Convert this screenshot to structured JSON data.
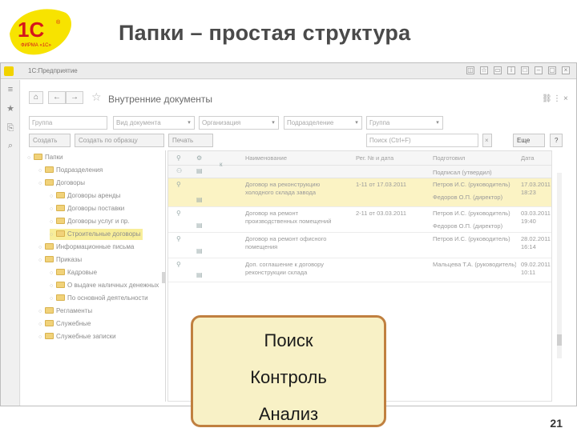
{
  "slide": {
    "title": "Папки – простая структура",
    "page_number": "21",
    "logo": {
      "brand": "1С",
      "subtext": "ФИРМА «1С»",
      "colors": {
        "yellow": "#f7e300",
        "red": "#d5161c"
      }
    }
  },
  "window": {
    "title": "1С:Предприятие",
    "controls": [
      "◫",
      "☆",
      "▭",
      "i",
      "□",
      "‒",
      "▢",
      "×"
    ]
  },
  "form": {
    "title": "Внутренние документы",
    "filters": [
      {
        "placeholder": "Группа"
      },
      {
        "placeholder": "Вид документа"
      },
      {
        "placeholder": "Организация"
      },
      {
        "placeholder": "Подразделение"
      },
      {
        "placeholder": "Группа"
      }
    ],
    "toolbar": {
      "create": "Создать",
      "create_by_template": "Создать по образцу",
      "print": "Печать",
      "more": "Еще",
      "help": "?",
      "search_placeholder": "Поиск (Ctrl+F)"
    }
  },
  "tree": [
    {
      "label": "Папки",
      "level": 0,
      "selected": false
    },
    {
      "label": "Подразделения",
      "level": 1,
      "selected": false
    },
    {
      "label": "Договоры",
      "level": 1,
      "selected": false
    },
    {
      "label": "Договоры аренды",
      "level": 2,
      "selected": false
    },
    {
      "label": "Договоры поставки",
      "level": 2,
      "selected": false
    },
    {
      "label": "Договоры услуг и пр.",
      "level": 2,
      "selected": false
    },
    {
      "label": "Строительные договоры",
      "level": 2,
      "selected": true
    },
    {
      "label": "Информационные письма",
      "level": 1,
      "selected": false
    },
    {
      "label": "Приказы",
      "level": 1,
      "selected": false
    },
    {
      "label": "Кадровые",
      "level": 2,
      "selected": false
    },
    {
      "label": "О выдаче наличных денежных",
      "level": 2,
      "selected": false
    },
    {
      "label": "По основной деятельности",
      "level": 2,
      "selected": false
    },
    {
      "label": "Регламенты",
      "level": 1,
      "selected": false
    },
    {
      "label": "Служебные",
      "level": 1,
      "selected": false
    },
    {
      "label": "Служебные записки",
      "level": 1,
      "selected": false
    }
  ],
  "table": {
    "columns": [
      "Наименование",
      "Рег. № и дата",
      "Подготовил",
      "Дата"
    ],
    "subheader": "Подписал (утвердил)",
    "rows": [
      {
        "name": "Договор на реконструкцию холодного склада завода",
        "reg": "1-11 от 17.03.2011",
        "prepared": "Петров И.С. (руководитель)",
        "signed": "Федоров О.П. (директор)",
        "date": "17.03.2011",
        "time": "18:23",
        "selected": true
      },
      {
        "name": "Договор на ремонт производственных помещений",
        "reg": "2-11 от 03.03.2011",
        "prepared": "Петров И.С. (руководитель)",
        "signed": "Федоров О.П. (директор)",
        "date": "03.03.2011",
        "time": "19:40",
        "selected": false
      },
      {
        "name": "Договор на ремонт офисного помещения",
        "reg": "",
        "prepared": "Петров И.С. (руководитель)",
        "signed": "",
        "date": "28.02.2011",
        "time": "16:14",
        "selected": false
      },
      {
        "name": "Доп. соглашение к договору реконструкции склада",
        "reg": "",
        "prepared": "Мальцева Т.А. (руководитель)",
        "signed": "",
        "date": "09.02.2011",
        "time": "10:11",
        "selected": false
      }
    ]
  },
  "callout": {
    "items": [
      "Поиск",
      "Контроль",
      "Анализ"
    ],
    "colors": {
      "fill": "#f8f1c6",
      "border": "#c08040"
    }
  },
  "icons": [
    "home-icon",
    "arrow-left-icon",
    "arrow-right-icon",
    "star-icon",
    "link-icon",
    "more-icon",
    "close-icon",
    "paperclip-icon",
    "document-icon",
    "folder-icon"
  ]
}
